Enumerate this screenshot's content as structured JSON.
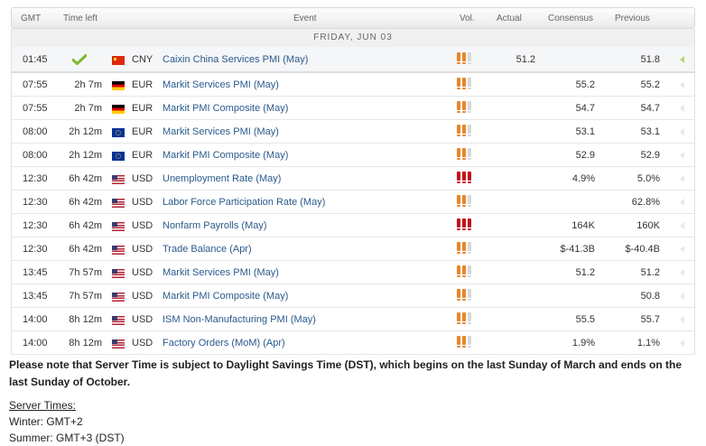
{
  "header": {
    "gmt": "GMT",
    "time_left": "Time left",
    "event": "Event",
    "vol": "Vol.",
    "actual": "Actual",
    "consensus": "Consensus",
    "previous": "Previous"
  },
  "day_label": "FRIDAY, JUN 03",
  "colors": {
    "high": "#c4121b",
    "medium": "#e8862a",
    "low_off": "#d8d8d8",
    "link": "#2a5a8c",
    "done_check": "#7cb82f"
  },
  "rows": [
    {
      "time": "01:45",
      "time_left": "",
      "done": true,
      "flag": "cn",
      "currency": "CNY",
      "event": "Caixin China Services PMI (May)",
      "volatility": 2,
      "actual": "51.2",
      "consensus": "",
      "previous": "51.8"
    },
    {
      "time": "07:55",
      "time_left": "2h 7m",
      "done": false,
      "flag": "de",
      "currency": "EUR",
      "event": "Markit Services PMI (May)",
      "volatility": 2,
      "actual": "",
      "consensus": "55.2",
      "previous": "55.2"
    },
    {
      "time": "07:55",
      "time_left": "2h 7m",
      "done": false,
      "flag": "de",
      "currency": "EUR",
      "event": "Markit PMI Composite (May)",
      "volatility": 2,
      "actual": "",
      "consensus": "54.7",
      "previous": "54.7"
    },
    {
      "time": "08:00",
      "time_left": "2h 12m",
      "done": false,
      "flag": "eu",
      "currency": "EUR",
      "event": "Markit Services PMI (May)",
      "volatility": 2,
      "actual": "",
      "consensus": "53.1",
      "previous": "53.1"
    },
    {
      "time": "08:00",
      "time_left": "2h 12m",
      "done": false,
      "flag": "eu",
      "currency": "EUR",
      "event": "Markit PMI Composite (May)",
      "volatility": 2,
      "actual": "",
      "consensus": "52.9",
      "previous": "52.9"
    },
    {
      "time": "12:30",
      "time_left": "6h 42m",
      "done": false,
      "flag": "us",
      "currency": "USD",
      "event": "Unemployment Rate (May)",
      "volatility": 3,
      "actual": "",
      "consensus": "4.9%",
      "previous": "5.0%"
    },
    {
      "time": "12:30",
      "time_left": "6h 42m",
      "done": false,
      "flag": "us",
      "currency": "USD",
      "event": "Labor Force Participation Rate (May)",
      "volatility": 2,
      "actual": "",
      "consensus": "",
      "previous": "62.8%"
    },
    {
      "time": "12:30",
      "time_left": "6h 42m",
      "done": false,
      "flag": "us",
      "currency": "USD",
      "event": "Nonfarm Payrolls (May)",
      "volatility": 3,
      "actual": "",
      "consensus": "164K",
      "previous": "160K"
    },
    {
      "time": "12:30",
      "time_left": "6h 42m",
      "done": false,
      "flag": "us",
      "currency": "USD",
      "event": "Trade Balance (Apr)",
      "volatility": 2,
      "actual": "",
      "consensus": "$-41.3B",
      "previous": "$-40.4B"
    },
    {
      "time": "13:45",
      "time_left": "7h 57m",
      "done": false,
      "flag": "us",
      "currency": "USD",
      "event": "Markit Services PMI (May)",
      "volatility": 2,
      "actual": "",
      "consensus": "51.2",
      "previous": "51.2"
    },
    {
      "time": "13:45",
      "time_left": "7h 57m",
      "done": false,
      "flag": "us",
      "currency": "USD",
      "event": "Markit PMI Composite (May)",
      "volatility": 2,
      "actual": "",
      "consensus": "",
      "previous": "50.8"
    },
    {
      "time": "14:00",
      "time_left": "8h 12m",
      "done": false,
      "flag": "us",
      "currency": "USD",
      "event": "ISM Non-Manufacturing PMI (May)",
      "volatility": 2,
      "actual": "",
      "consensus": "55.5",
      "previous": "55.7"
    },
    {
      "time": "14:00",
      "time_left": "8h 12m",
      "done": false,
      "flag": "us",
      "currency": "USD",
      "event": "Factory Orders (MoM) (Apr)",
      "volatility": 2,
      "actual": "",
      "consensus": "1.9%",
      "previous": "1.1%"
    }
  ],
  "note": "Please note that Server Time is subject to Daylight Savings Time (DST), which begins on the last Sunday of March and ends on the last Sunday of October.",
  "server_times": {
    "title": "Server Times:",
    "winter": "Winter: GMT+2",
    "summer": "Summer: GMT+3 (DST)"
  }
}
